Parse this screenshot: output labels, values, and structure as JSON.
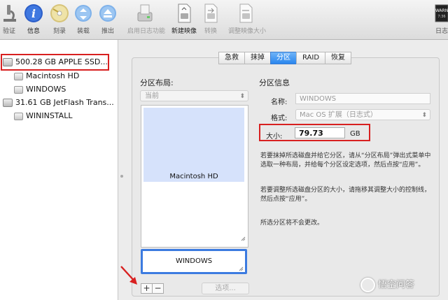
{
  "toolbar": {
    "items": [
      {
        "label": "验证",
        "icon": "microscope-icon"
      },
      {
        "label": "信息",
        "icon": "info-icon"
      },
      {
        "label": "刻录",
        "icon": "burn-disc-icon"
      },
      {
        "label": "装载",
        "icon": "mount-icon"
      },
      {
        "label": "推出",
        "icon": "eject-icon"
      },
      {
        "label": "启用日志功能",
        "icon": "journal-icon"
      },
      {
        "label": "新建映像",
        "icon": "new-image-icon"
      },
      {
        "label": "转换",
        "icon": "convert-icon"
      },
      {
        "label": "调整映像大小",
        "icon": "resize-image-icon"
      },
      {
        "label": "日志",
        "icon": "log-icon"
      }
    ]
  },
  "sidebar": {
    "devices": [
      {
        "label": "500.28 GB APPLE SSD...",
        "volumes": [
          "Macintosh HD",
          "WINDOWS"
        ]
      },
      {
        "label": "31.61 GB JetFlash Trans...",
        "volumes": [
          "WININSTALL"
        ]
      }
    ]
  },
  "tabs": [
    "急救",
    "抹掉",
    "分区",
    "RAID",
    "恢复"
  ],
  "selected_tab": "分区",
  "layout": {
    "heading": "分区布局:",
    "scheme": "当前",
    "partitions": [
      {
        "name": "Macintosh HD"
      },
      {
        "name": "WINDOWS"
      }
    ],
    "options_button": "选项..."
  },
  "info": {
    "heading": "分区信息",
    "name_label": "名称:",
    "name_value": "WINDOWS",
    "format_label": "格式:",
    "format_value": "Mac OS 扩展（日志式）",
    "size_label": "大小:",
    "size_value": "79.73",
    "size_unit": "GB",
    "help1": "若要抹掉所选磁盘并给它分区，请从“分区布局”弹出式菜单中选取一种布局，并给每个分区设定选项，然后点按“应用”。",
    "help2": "若要调整所选磁盘分区的大小，请拖移其调整大小的控制线，然后点按“应用”。",
    "help3": "所选分区将不会更改。"
  },
  "watermark": "悟空问答",
  "colors": {
    "highlight_box": "#d82020",
    "selected_tab": "#2a86ee",
    "partition_fill": "#d6e2fb",
    "selected_partition_border": "#3c7be0"
  }
}
